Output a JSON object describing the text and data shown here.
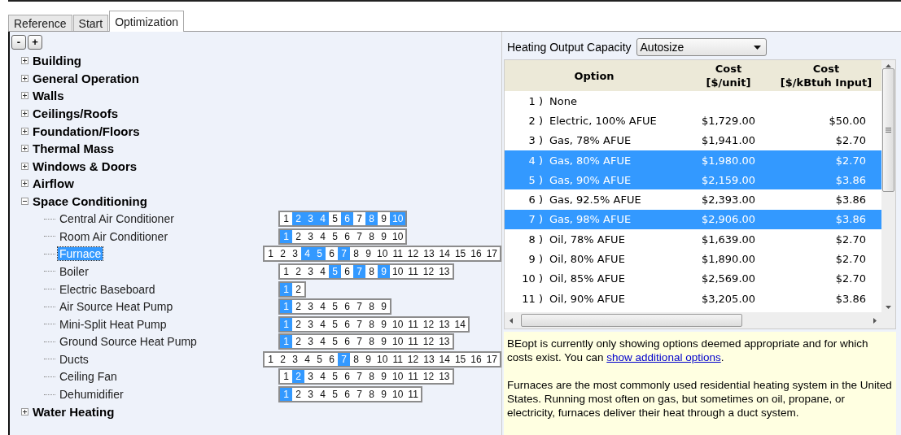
{
  "tabs": [
    {
      "label": "Reference",
      "selected": false
    },
    {
      "label": "Start",
      "selected": false
    },
    {
      "label": "Optimization",
      "selected": true
    }
  ],
  "tree_buttons": [
    "-",
    "+"
  ],
  "tree": [
    {
      "label": "Building",
      "expanded": false
    },
    {
      "label": "General Operation",
      "expanded": false
    },
    {
      "label": "Walls",
      "expanded": false
    },
    {
      "label": "Ceilings/Roofs",
      "expanded": false
    },
    {
      "label": "Foundation/Floors",
      "expanded": false
    },
    {
      "label": "Thermal Mass",
      "expanded": false
    },
    {
      "label": "Windows & Doors",
      "expanded": false
    },
    {
      "label": "Airflow",
      "expanded": false
    },
    {
      "label": "Space Conditioning",
      "expanded": true,
      "children": [
        {
          "label": "Central Air Conditioner",
          "selected": false,
          "options": [
            {
              "label": "1",
              "selected": false
            },
            {
              "label": "2",
              "selected": true
            },
            {
              "label": "3",
              "selected": true
            },
            {
              "label": "4",
              "selected": true
            },
            {
              "label": "5",
              "selected": false
            },
            {
              "label": "6",
              "selected": true
            },
            {
              "label": "7",
              "selected": false
            },
            {
              "label": "8",
              "selected": true
            },
            {
              "label": "9",
              "selected": false
            },
            {
              "label": "10",
              "selected": true
            }
          ]
        },
        {
          "label": "Room Air Conditioner",
          "selected": false,
          "options": [
            {
              "label": "1",
              "selected": true
            },
            {
              "label": "2",
              "selected": false
            },
            {
              "label": "3",
              "selected": false
            },
            {
              "label": "4",
              "selected": false
            },
            {
              "label": "5",
              "selected": false
            },
            {
              "label": "6",
              "selected": false
            },
            {
              "label": "7",
              "selected": false
            },
            {
              "label": "8",
              "selected": false
            },
            {
              "label": "9",
              "selected": false
            },
            {
              "label": "10",
              "selected": false
            }
          ]
        },
        {
          "label": "Furnace",
          "selected": true,
          "options": [
            {
              "label": "1",
              "selected": false
            },
            {
              "label": "2",
              "selected": false
            },
            {
              "label": "3",
              "selected": false
            },
            {
              "label": "4",
              "selected": true
            },
            {
              "label": "5",
              "selected": true
            },
            {
              "label": "6",
              "selected": false
            },
            {
              "label": "7",
              "selected": true
            },
            {
              "label": "8",
              "selected": false
            },
            {
              "label": "9",
              "selected": false
            },
            {
              "label": "10",
              "selected": false
            },
            {
              "label": "11",
              "selected": false
            },
            {
              "label": "12",
              "selected": false
            },
            {
              "label": "13",
              "selected": false
            },
            {
              "label": "14",
              "selected": false
            },
            {
              "label": "15",
              "selected": false
            },
            {
              "label": "16",
              "selected": false
            },
            {
              "label": "17",
              "selected": false
            }
          ]
        },
        {
          "label": "Boiler",
          "selected": false,
          "options": [
            {
              "label": "1",
              "selected": false
            },
            {
              "label": "2",
              "selected": false
            },
            {
              "label": "3",
              "selected": false
            },
            {
              "label": "4",
              "selected": false
            },
            {
              "label": "5",
              "selected": true
            },
            {
              "label": "6",
              "selected": false
            },
            {
              "label": "7",
              "selected": true
            },
            {
              "label": "8",
              "selected": false
            },
            {
              "label": "9",
              "selected": true
            },
            {
              "label": "10",
              "selected": false
            },
            {
              "label": "11",
              "selected": false
            },
            {
              "label": "12",
              "selected": false
            },
            {
              "label": "13",
              "selected": false
            }
          ]
        },
        {
          "label": "Electric Baseboard",
          "selected": false,
          "options": [
            {
              "label": "1",
              "selected": true
            },
            {
              "label": "2",
              "selected": false
            }
          ]
        },
        {
          "label": "Air Source Heat Pump",
          "selected": false,
          "options": [
            {
              "label": "1",
              "selected": true
            },
            {
              "label": "2",
              "selected": false
            },
            {
              "label": "3",
              "selected": false
            },
            {
              "label": "4",
              "selected": false
            },
            {
              "label": "5",
              "selected": false
            },
            {
              "label": "6",
              "selected": false
            },
            {
              "label": "7",
              "selected": false
            },
            {
              "label": "8",
              "selected": false
            },
            {
              "label": "9",
              "selected": false
            }
          ]
        },
        {
          "label": "Mini-Split Heat Pump",
          "selected": false,
          "options": [
            {
              "label": "1",
              "selected": true
            },
            {
              "label": "2",
              "selected": false
            },
            {
              "label": "3",
              "selected": false
            },
            {
              "label": "4",
              "selected": false
            },
            {
              "label": "5",
              "selected": false
            },
            {
              "label": "6",
              "selected": false
            },
            {
              "label": "7",
              "selected": false
            },
            {
              "label": "8",
              "selected": false
            },
            {
              "label": "9",
              "selected": false
            },
            {
              "label": "10",
              "selected": false
            },
            {
              "label": "11",
              "selected": false
            },
            {
              "label": "12",
              "selected": false
            },
            {
              "label": "13",
              "selected": false
            },
            {
              "label": "14",
              "selected": false
            }
          ]
        },
        {
          "label": "Ground Source Heat Pump",
          "selected": false,
          "options": [
            {
              "label": "1",
              "selected": true
            },
            {
              "label": "2",
              "selected": false
            },
            {
              "label": "3",
              "selected": false
            },
            {
              "label": "4",
              "selected": false
            },
            {
              "label": "5",
              "selected": false
            },
            {
              "label": "6",
              "selected": false
            },
            {
              "label": "7",
              "selected": false
            },
            {
              "label": "8",
              "selected": false
            },
            {
              "label": "9",
              "selected": false
            },
            {
              "label": "10",
              "selected": false
            },
            {
              "label": "11",
              "selected": false
            },
            {
              "label": "12",
              "selected": false
            },
            {
              "label": "13",
              "selected": false
            }
          ]
        },
        {
          "label": "Ducts",
          "selected": false,
          "options": [
            {
              "label": "1",
              "selected": false
            },
            {
              "label": "2",
              "selected": false
            },
            {
              "label": "3",
              "selected": false
            },
            {
              "label": "4",
              "selected": false
            },
            {
              "label": "5",
              "selected": false
            },
            {
              "label": "6",
              "selected": false
            },
            {
              "label": "7",
              "selected": true
            },
            {
              "label": "8",
              "selected": false
            },
            {
              "label": "9",
              "selected": false
            },
            {
              "label": "10",
              "selected": false
            },
            {
              "label": "11",
              "selected": false
            },
            {
              "label": "12",
              "selected": false
            },
            {
              "label": "13",
              "selected": false
            },
            {
              "label": "14",
              "selected": false
            },
            {
              "label": "15",
              "selected": false
            },
            {
              "label": "16",
              "selected": false
            },
            {
              "label": "17",
              "selected": false
            }
          ]
        },
        {
          "label": "Ceiling Fan",
          "selected": false,
          "options": [
            {
              "label": "1",
              "selected": false
            },
            {
              "label": "2",
              "selected": true
            },
            {
              "label": "3",
              "selected": false
            },
            {
              "label": "4",
              "selected": false
            },
            {
              "label": "5",
              "selected": false
            },
            {
              "label": "6",
              "selected": false
            },
            {
              "label": "7",
              "selected": false
            },
            {
              "label": "8",
              "selected": false
            },
            {
              "label": "9",
              "selected": false
            },
            {
              "label": "10",
              "selected": false
            },
            {
              "label": "11",
              "selected": false
            },
            {
              "label": "12",
              "selected": false
            },
            {
              "label": "13",
              "selected": false
            }
          ]
        },
        {
          "label": "Dehumidifier",
          "selected": false,
          "options": [
            {
              "label": "1",
              "selected": true
            },
            {
              "label": "2",
              "selected": false
            },
            {
              "label": "3",
              "selected": false
            },
            {
              "label": "4",
              "selected": false
            },
            {
              "label": "5",
              "selected": false
            },
            {
              "label": "6",
              "selected": false
            },
            {
              "label": "7",
              "selected": false
            },
            {
              "label": "8",
              "selected": false
            },
            {
              "label": "9",
              "selected": false
            },
            {
              "label": "10",
              "selected": false
            },
            {
              "label": "11",
              "selected": false
            }
          ]
        }
      ]
    },
    {
      "label": "Water Heating",
      "expanded": false
    }
  ],
  "capacity": {
    "label": "Heating Output Capacity",
    "value": "Autosize"
  },
  "table": {
    "columns": [
      "Option",
      "Cost\n[$/unit]",
      "Cost\n[$/kBtuh Input]"
    ],
    "rows": [
      {
        "number": "1 )",
        "option": "None",
        "selected": false
      },
      {
        "number": "2 )",
        "option": "Electric, 100% AFUE",
        "cost_unit": "$1,729.00",
        "cost_input": "$50.00",
        "selected": false
      },
      {
        "number": "3 )",
        "option": "Gas, 78% AFUE",
        "cost_unit": "$1,941.00",
        "cost_input": "$2.70",
        "selected": false
      },
      {
        "number": "4 )",
        "option": "Gas, 80% AFUE",
        "cost_unit": "$1,980.00",
        "cost_input": "$2.70",
        "selected": true
      },
      {
        "number": "5 )",
        "option": "Gas, 90% AFUE",
        "cost_unit": "$2,159.00",
        "cost_input": "$3.86",
        "selected": true
      },
      {
        "number": "6 )",
        "option": "Gas, 92.5% AFUE",
        "cost_unit": "$2,393.00",
        "cost_input": "$3.86",
        "selected": false
      },
      {
        "number": "7 )",
        "option": "Gas, 98% AFUE",
        "cost_unit": "$2,906.00",
        "cost_input": "$3.86",
        "selected": true
      },
      {
        "number": "8 )",
        "option": "Oil, 78% AFUE",
        "cost_unit": "$1,639.00",
        "cost_input": "$2.70",
        "selected": false
      },
      {
        "number": "9 )",
        "option": "Oil, 80% AFUE",
        "cost_unit": "$1,890.00",
        "cost_input": "$2.70",
        "selected": false
      },
      {
        "number": "10 )",
        "option": "Oil, 85% AFUE",
        "cost_unit": "$2,569.00",
        "cost_input": "$2.70",
        "selected": false
      },
      {
        "number": "11 )",
        "option": "Oil, 90% AFUE",
        "cost_unit": "$3,205.00",
        "cost_input": "$3.86",
        "selected": false
      }
    ]
  },
  "info": {
    "note": "BEopt is currently only showing options deemed appropriate and for which costs exist. You can",
    "link": "show additional options",
    "note_end": ".",
    "description": "Furnaces are the most commonly used residential heating system in the United States. Running most often on gas, but sometimes on oil, propane, or electricity, furnaces deliver their heat through a duct system."
  }
}
